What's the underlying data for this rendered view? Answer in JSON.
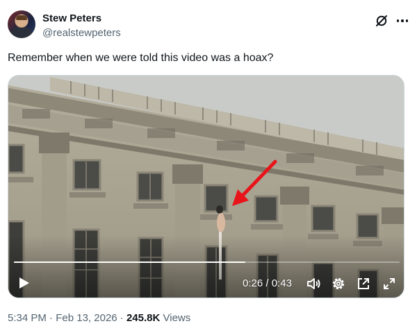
{
  "author": {
    "name": "Stew Peters",
    "handle": "@realstewpeters"
  },
  "tweet": {
    "text": "Remember when we were told this video was a hoax?"
  },
  "video": {
    "current_time": "0:26",
    "separator": "/",
    "duration": "0:43",
    "progress_fraction": 0.6
  },
  "footer": {
    "time": "5:34 PM",
    "date": "Feb 13, 2026",
    "dot": "·",
    "views_count": "245.8K",
    "views_label": "Views"
  },
  "icons": {
    "grok": "grok-icon",
    "more": "more-options-icon",
    "play": "play-icon",
    "volume": "volume-icon",
    "settings": "settings-gear-icon",
    "popout": "popout-icon",
    "fullscreen": "fullscreen-icon",
    "arrow": "red-arrow-annotation"
  },
  "colors": {
    "text_primary": "#0f1419",
    "text_secondary": "#536471",
    "annotation_arrow": "#e8141a"
  }
}
